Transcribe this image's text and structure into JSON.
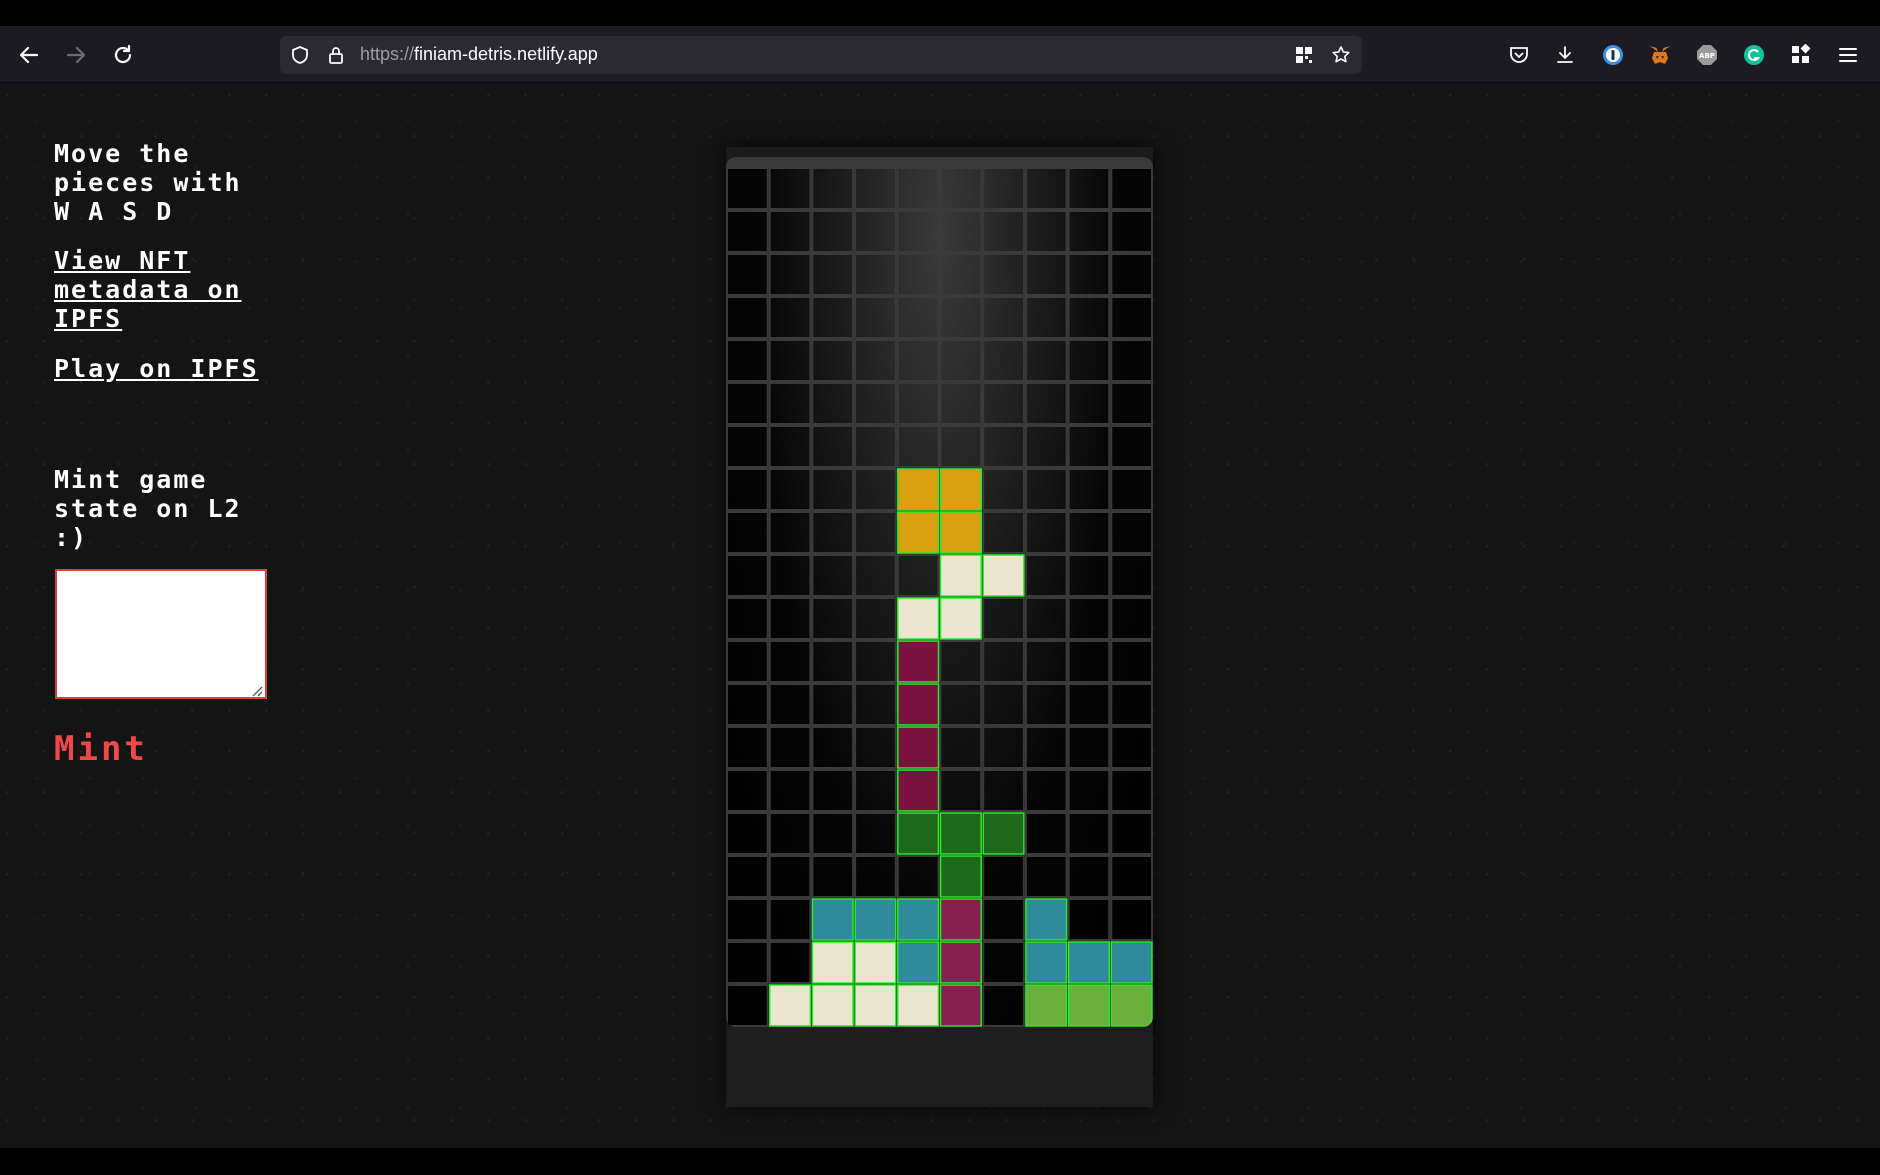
{
  "browser": {
    "url_prefix": "https://",
    "url_host": "finiam-detris.netlify.app",
    "extensions": [
      "pocket-icon",
      "download-icon",
      "1password-icon",
      "metamask-icon",
      "adblock-icon",
      "grammarly-icon",
      "extensions-icon",
      "menu-icon"
    ]
  },
  "sidebar": {
    "instructions": "Move the\npieces with\nW A S D",
    "nft_link": "View NFT\nmetadata on\nIPFS",
    "play_link": "Play on IPFS",
    "mint_prompt": "Mint game\nstate on L2\n:)",
    "mint_input_value": "",
    "mint_button": "Mint"
  },
  "board": {
    "cols": 10,
    "rows": 20,
    "colors": {
      "Y": "#d9a00f",
      "W": "#ebe6cf",
      "M": "#7a1240",
      "P": "#85204f",
      "G": "#1f6a1a",
      "T": "#2f8a99",
      "L": "#6bb03c"
    },
    "cells": [
      "..........",
      "..........",
      "..........",
      "..........",
      "..........",
      "..........",
      "..........",
      "....YY....",
      "....YY....",
      ".....WW...",
      "....WW....",
      "....M.....",
      "....M.....",
      "....M.....",
      "....M.....",
      "....GGG...",
      ".....G....",
      "..TTTP.T..",
      "..WWTP.TTT",
      ".WWWWP.LLL"
    ]
  }
}
